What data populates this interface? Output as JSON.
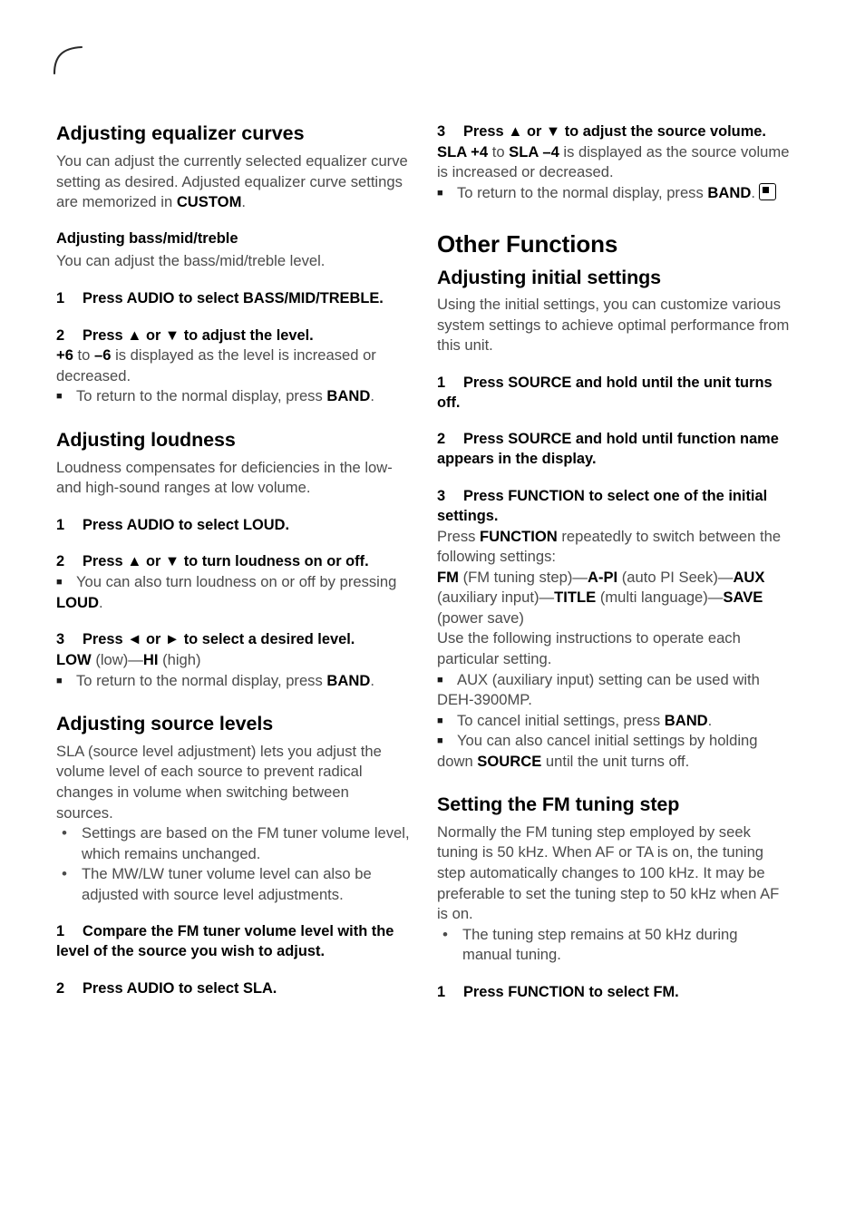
{
  "page": {
    "corner_mark": "corner-arc"
  },
  "left_column": {
    "eq_heading": "Adjusting equalizer curves",
    "eq_intro_pre": "You can adjust the currently selected equalizer curve setting as desired. Adjusted equalizer curve settings are memorized in ",
    "eq_intro_bold": "CUSTOM",
    "eq_intro_post": ".",
    "bass_heading": "Adjusting bass/mid/treble",
    "bass_intro": "You can adjust the bass/mid/treble level.",
    "bass_step1_num": "1",
    "bass_step1_text": "Press AUDIO to select BASS/MID/TREBLE.",
    "bass_step2_num": "2",
    "bass_step2_text": "Press ▲ or ▼ to adjust the level.",
    "bass_step2_b1": "+6",
    "bass_step2_mid": " to ",
    "bass_step2_b2": "–6",
    "bass_step2_tail": " is displayed as the level is increased or decreased.",
    "bass_note_pre": "To return to the normal display, press ",
    "bass_note_bold": "BAND",
    "bass_note_post": ".",
    "loud_heading": "Adjusting loudness",
    "loud_intro": "Loudness compensates for deficiencies in the low- and high-sound ranges at low volume.",
    "loud_step1_num": "1",
    "loud_step1_text": "Press AUDIO to select LOUD.",
    "loud_step2_num": "2",
    "loud_step2_text": "Press ▲ or ▼ to turn loudness on or off.",
    "loud_note1_pre": "You can also turn loudness on or off by pressing ",
    "loud_note1_bold": "LOUD",
    "loud_note1_post": ".",
    "loud_step3_num": "3",
    "loud_step3_text": "Press ◄ or ► to select a desired level.",
    "loud_range_b1": "LOW",
    "loud_range_t1": " (low)—",
    "loud_range_b2": "HI",
    "loud_range_t2": " (high)",
    "loud_note2_pre": "To return to the normal display, press ",
    "loud_note2_bold": "BAND",
    "loud_note2_post": ".",
    "sla_heading": "Adjusting source levels",
    "sla_intro": "SLA (source level adjustment) lets you adjust the volume level of each source to prevent radical changes in volume when switching between sources.",
    "sla_bullets": [
      "Settings are based on the FM tuner volume level, which remains unchanged.",
      "The MW/LW tuner volume level can also be adjusted with source level adjustments."
    ],
    "sla_step1_num": "1",
    "sla_step1_text": "Compare the FM tuner volume level with the level of the source you wish to adjust.",
    "sla_step2_num": "2",
    "sla_step2_text": "Press AUDIO to select SLA."
  },
  "right_column": {
    "sla_step3_num": "3",
    "sla_step3_text": "Press ▲ or ▼ to adjust the source volume.",
    "sla_step3_b1": "SLA +4",
    "sla_step3_mid": " to ",
    "sla_step3_b2": "SLA –4",
    "sla_step3_tail": " is displayed as the source volume is increased or decreased.",
    "sla_note_pre": "To return to the normal display, press ",
    "sla_note_bold": "BAND",
    "sla_note_post": ".",
    "end_marker": "end-of-section-marker",
    "chapter_heading": "Other Functions",
    "initial_heading": "Adjusting initial settings",
    "initial_intro": "Using the initial settings, you can customize various system settings to achieve optimal performance from this unit.",
    "init_step1_num": "1",
    "init_step1_text": "Press SOURCE and hold until the unit turns off.",
    "init_step2_num": "2",
    "init_step2_text": "Press SOURCE and hold until function name appears in the display.",
    "init_step3_num": "3",
    "init_step3_text": "Press FUNCTION to select one of the initial settings.",
    "init_press_pre": "Press ",
    "init_press_bold": "FUNCTION",
    "init_press_post": " repeatedly to switch between the following settings:",
    "settings_chain": [
      {
        "bold": "FM",
        "plain": " (FM tuning step)—"
      },
      {
        "bold": "A-PI",
        "plain": " (auto PI Seek)—"
      },
      {
        "bold": "AUX",
        "plain": " (auxiliary input)—"
      },
      {
        "bold": "TITLE",
        "plain": " (multi language)—"
      },
      {
        "bold": "SAVE",
        "plain": " (power save)"
      }
    ],
    "init_use_following": "Use the following instructions to operate each particular setting.",
    "init_note1": "AUX (auxiliary input) setting can be used with DEH-3900MP.",
    "init_note2_pre": "To cancel initial settings, press ",
    "init_note2_bold": "BAND",
    "init_note2_post": ".",
    "init_note3_pre": "You can also cancel initial settings by holding down ",
    "init_note3_bold": "SOURCE",
    "init_note3_post": " until the unit turns off.",
    "fm_heading": "Setting the FM tuning step",
    "fm_intro": "Normally the FM tuning step employed by seek tuning is 50 kHz. When AF or TA is on, the tuning step automatically changes to 100 kHz. It may be preferable to set the tuning step to 50 kHz when AF is on.",
    "fm_bullets": [
      "The tuning step remains at 50 kHz during manual tuning."
    ],
    "fm_step1_num": "1",
    "fm_step1_text": "Press FUNCTION to select FM."
  }
}
